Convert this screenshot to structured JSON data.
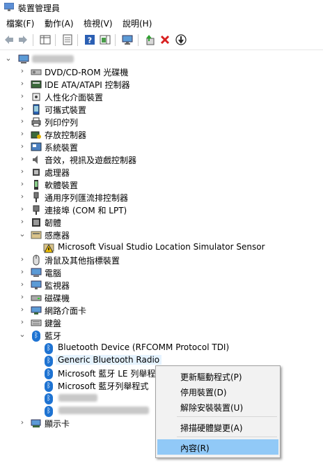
{
  "window": {
    "title": "裝置管理員"
  },
  "menu": [
    "檔案(F)",
    "動作(A)",
    "檢視(V)",
    "說明(H)"
  ],
  "tree": {
    "root": {
      "label": ""
    },
    "categories": [
      {
        "label": "DVD/CD-ROM 光碟機",
        "icon": "dvd-drive-icon",
        "expanded": false
      },
      {
        "label": "IDE ATA/ATAPI 控制器",
        "icon": "ide-controller-icon",
        "expanded": false
      },
      {
        "label": "人性化介面裝置",
        "icon": "hid-icon",
        "expanded": false
      },
      {
        "label": "可攜式裝置",
        "icon": "portable-device-icon",
        "expanded": false
      },
      {
        "label": "列印佇列",
        "icon": "print-queue-icon",
        "expanded": false
      },
      {
        "label": "存放控制器",
        "icon": "storage-controller-icon",
        "expanded": false
      },
      {
        "label": "系統裝置",
        "icon": "system-device-icon",
        "expanded": false
      },
      {
        "label": "音效，視訊及遊戲控制器",
        "icon": "audio-icon",
        "expanded": false
      },
      {
        "label": "處理器",
        "icon": "processor-icon",
        "expanded": false
      },
      {
        "label": "軟體裝置",
        "icon": "software-device-icon",
        "expanded": false
      },
      {
        "label": "通用序列匯流排控制器",
        "icon": "usb-icon",
        "expanded": false
      },
      {
        "label": "連接埠 (COM 和 LPT)",
        "icon": "port-icon",
        "expanded": false
      },
      {
        "label": "韌體",
        "icon": "firmware-icon",
        "expanded": false
      },
      {
        "label": "感應器",
        "icon": "sensor-icon",
        "expanded": true,
        "children": [
          {
            "label": "Microsoft Visual Studio Location Simulator Sensor",
            "icon": "sensor-warning-icon"
          }
        ]
      },
      {
        "label": "滑鼠及其他指標裝置",
        "icon": "mouse-icon",
        "expanded": false
      },
      {
        "label": "電腦",
        "icon": "computer-icon",
        "expanded": false
      },
      {
        "label": "監視器",
        "icon": "monitor-icon",
        "expanded": false
      },
      {
        "label": "磁碟機",
        "icon": "disk-drive-icon",
        "expanded": false
      },
      {
        "label": "網路介面卡",
        "icon": "network-adapter-icon",
        "expanded": false
      },
      {
        "label": "鍵盤",
        "icon": "keyboard-icon",
        "expanded": false
      },
      {
        "label": "藍牙",
        "icon": "bluetooth-icon",
        "expanded": true,
        "children": [
          {
            "label": "Bluetooth Device (RFCOMM Protocol TDI)",
            "icon": "bluetooth-icon"
          },
          {
            "label": "Generic Bluetooth Radio",
            "icon": "bluetooth-icon",
            "selected": true
          },
          {
            "label": "Microsoft 藍牙 LE 列舉程式",
            "icon": "bluetooth-icon"
          },
          {
            "label": "Microsoft 藍牙列舉程式",
            "icon": "bluetooth-icon"
          },
          {
            "label": "",
            "icon": "bluetooth-icon"
          },
          {
            "label": "",
            "icon": "bluetooth-icon"
          }
        ]
      },
      {
        "label": "顯示卡",
        "icon": "display-adapter-icon",
        "expanded": false
      }
    ]
  },
  "context_menu": {
    "items": [
      "更新驅動程式(P)",
      "停用裝置(D)",
      "解除安裝裝置(U)",
      "掃描硬體變更(A)",
      "內容(R)"
    ],
    "highlighted": "內容(R)"
  },
  "colors": {
    "bluetooth": "#1e73d2",
    "highlight": "#91c9f7",
    "selected": "#e5f3ff"
  }
}
